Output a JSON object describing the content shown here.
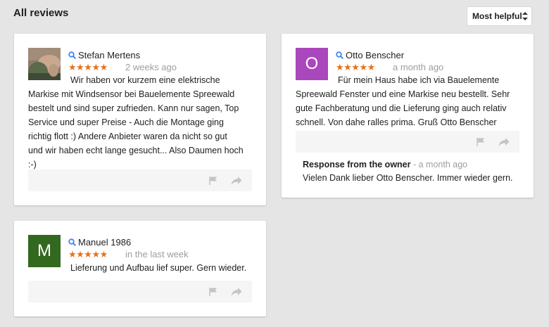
{
  "header": {
    "title": "All reviews",
    "sort_label": "Most helpful"
  },
  "colors": {
    "star": "#e7711b",
    "avatar_otto": "#ab47bc",
    "avatar_manuel": "#33691e"
  },
  "reviews": [
    {
      "author": "Stefan Mertens",
      "stars": "★★★★★",
      "date": "2 weeks ago",
      "avatar": "photo",
      "lines": [
        "Wir haben vor kurzem eine elektrische",
        "Markise mit Windsensor bei Bauelemente Spreewald",
        "bestelt und sind super zufrieden. Kann nur sagen, Top",
        "Service und super Preise - Auch die Montage ging",
        "richtig flott :) Andere Anbieter waren da nicht so gut",
        "und wir haben echt lange gesucht... Also Daumen hoch",
        ":-)"
      ]
    },
    {
      "author": "Otto Benscher",
      "stars": "★★★★★",
      "date": "a month ago",
      "avatar_letter": "O",
      "lines": [
        "Für mein Haus habe ich via Bauelemente",
        "Spreewald Fenster und eine Markise neu bestellt. Sehr",
        "gute Fachberatung und die Lieferung ging auch relativ",
        "schnell. Von dahe ralles prima. Gruß Otto Benscher"
      ],
      "response": {
        "label": "Response from the owner",
        "date": " - a month ago",
        "text": "Vielen Dank lieber Otto Benscher. Immer wieder gern."
      }
    },
    {
      "author": "Manuel 1986",
      "stars": "★★★★★",
      "date": "in the last week",
      "avatar_letter": "M",
      "lines": [
        "Lieferung und Aufbau lief super. Gern wieder."
      ]
    }
  ]
}
